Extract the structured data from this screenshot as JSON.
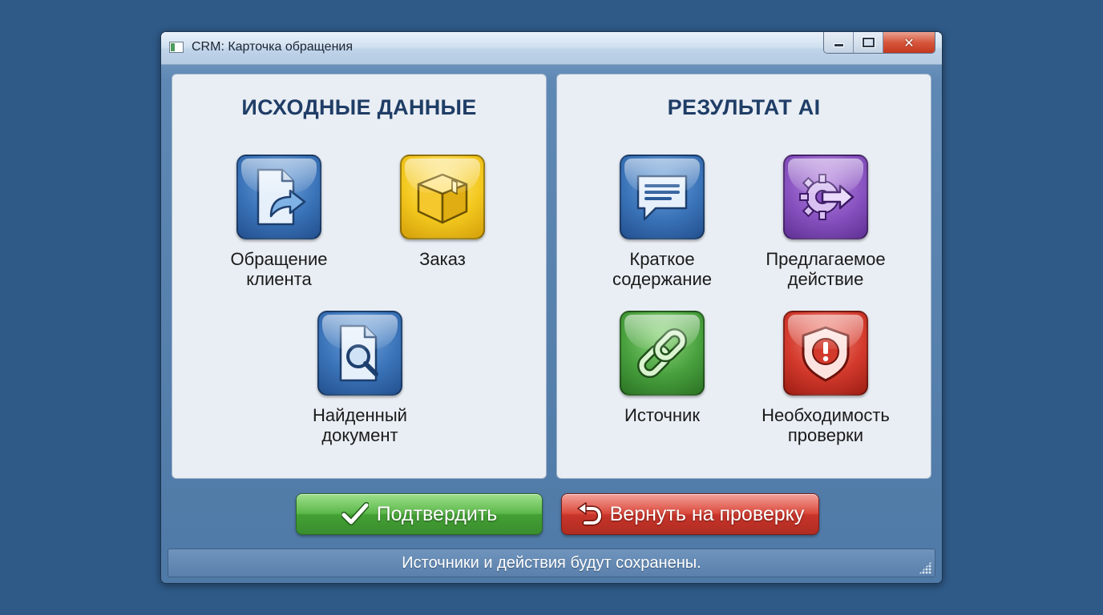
{
  "window": {
    "title": "CRM: Карточка обращения",
    "controls": {
      "minimize": "minimize",
      "maximize": "maximize",
      "close": "✕"
    }
  },
  "left_panel": {
    "title": "ИСХОДНЫЕ ДАННЫЕ",
    "items": [
      {
        "label": "Обращение клиента",
        "icon": "document-forward-icon",
        "color": "#3a73b8"
      },
      {
        "label": "Заказ",
        "icon": "package-box-icon",
        "color": "#f3c81e"
      },
      {
        "label": "Найденный документ",
        "icon": "document-search-icon",
        "color": "#3a73b8"
      }
    ]
  },
  "right_panel": {
    "title": "РЕЗУЛЬТАТ AI",
    "items": [
      {
        "label": "Краткое содержание",
        "icon": "speech-bubble-icon",
        "color": "#3a73b8"
      },
      {
        "label": "Предлагаемое действие",
        "icon": "gear-arrow-icon",
        "color": "#8852c0"
      },
      {
        "label": "Источник",
        "icon": "chain-link-icon",
        "color": "#48a03d"
      },
      {
        "label": "Необходимость проверки",
        "icon": "warning-shield-icon",
        "color": "#d33a2c"
      }
    ]
  },
  "actions": {
    "confirm_label": "Подтвердить",
    "return_label": "Вернуть на проверку",
    "confirm_color": "#4fae3c",
    "return_color": "#cc3a2e"
  },
  "status": {
    "text": "Источники и действия будут сохранены."
  }
}
